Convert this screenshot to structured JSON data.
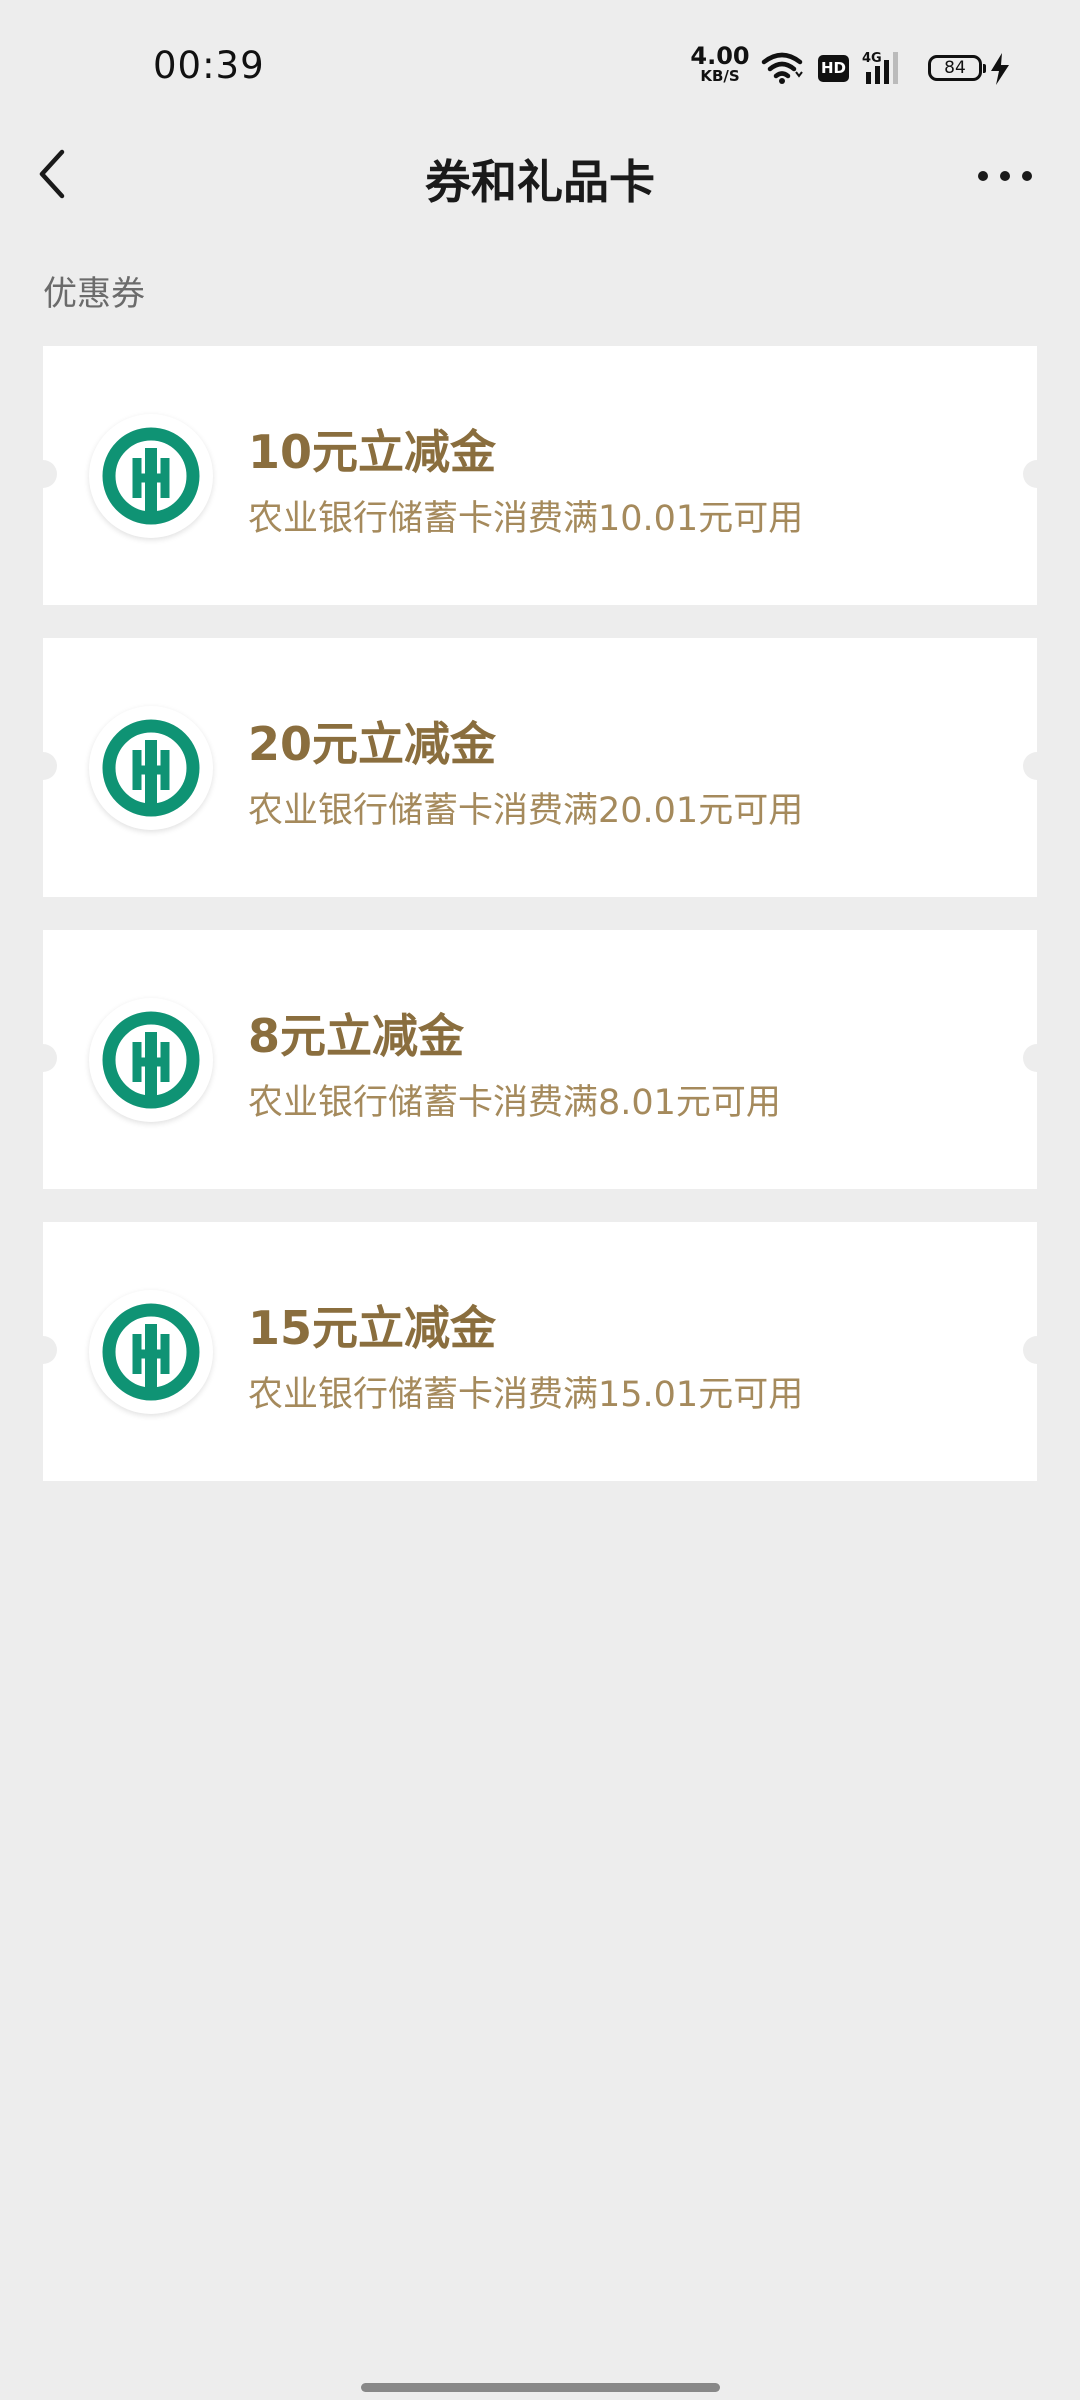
{
  "status_bar": {
    "time": "00:39",
    "net_speed_value": "4.00",
    "net_speed_unit": "KB/S",
    "hd_label": "HD",
    "network_type": "4G",
    "battery_level": "84"
  },
  "header": {
    "title": "券和礼品卡",
    "back_icon": "chevron-left-icon",
    "more_icon": "more-dots-icon"
  },
  "section": {
    "label": "优惠券"
  },
  "coupons": [
    {
      "title": "10元立减金",
      "desc": "农业银行储蓄卡消费满10.01元可用",
      "logo_icon": "abc-bank-logo-icon"
    },
    {
      "title": "20元立减金",
      "desc": "农业银行储蓄卡消费满20.01元可用",
      "logo_icon": "abc-bank-logo-icon"
    },
    {
      "title": "8元立减金",
      "desc": "农业银行储蓄卡消费满8.01元可用",
      "logo_icon": "abc-bank-logo-icon"
    },
    {
      "title": "15元立减金",
      "desc": "农业银行储蓄卡消费满15.01元可用",
      "logo_icon": "abc-bank-logo-icon"
    }
  ],
  "colors": {
    "background": "#ededed",
    "card": "#ffffff",
    "coupon_title": "#8a6e3e",
    "coupon_desc": "#a58a5c",
    "bank_logo": "#0f9374"
  }
}
